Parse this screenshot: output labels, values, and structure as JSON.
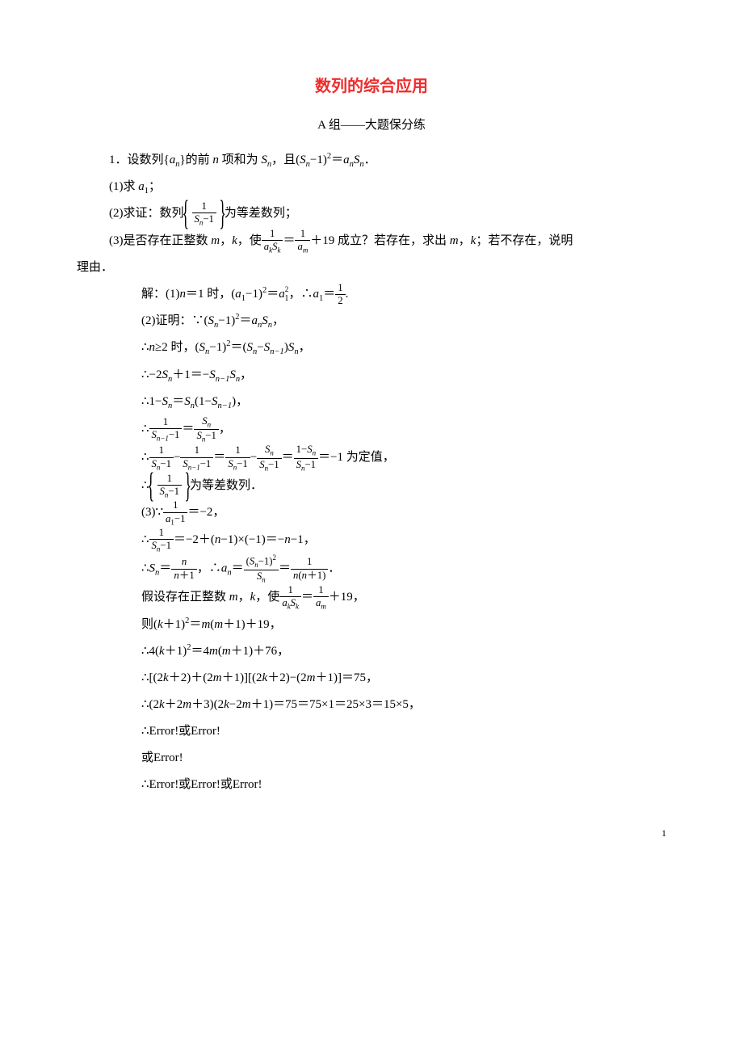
{
  "title": "数列的综合应用",
  "subtitle": "A 组——大题保分练",
  "p1": "1．设数列{",
  "p1b": "}的前 ",
  "p1c": " 项和为 ",
  "p1d": "，且(",
  "p1e": "−1)",
  "p1f": "＝",
  "p1g": "．",
  "q1": "(1)求 ",
  "q1b": "；",
  "q2a": "(2)求证：数列",
  "q2b": "为等差数列；",
  "q3a": "(3)是否存在正整数 ",
  "q3b": "，",
  "q3c": "，使",
  "q3d": "＝",
  "q3e": "＋19 成立？若存在，求出 ",
  "q3f": "，",
  "q3g": "；若不存在，说明",
  "q3h": "理由．",
  "s1a": "解：(1)",
  "s1b": "＝1 时，(",
  "s1c": "−1)",
  "s1d": "＝",
  "s1e": "，∴",
  "s1f": "＝",
  "s1g": ".",
  "s2a": "(2)证明：∵(",
  "s2b": "−1)",
  "s2c": "＝",
  "s2d": "，",
  "s3a": "∴",
  "s3b": "≥2 时，(",
  "s3c": "−1)",
  "s3d": "＝(",
  "s3e": "−",
  "s3f": ")",
  "s3g": "，",
  "s4a": "∴−2",
  "s4b": "＋1＝−",
  "s4c": "，",
  "s5a": "∴1−",
  "s5b": "＝",
  "s5c": "(1−",
  "s5d": ")，",
  "s6a": "∴",
  "s6b": "＝",
  "s6c": "，",
  "s7a": "∴",
  "s7b": "−",
  "s7c": "＝",
  "s7d": "−",
  "s7e": "＝",
  "s7f": "＝−1 为定值，",
  "s8a": "∴",
  "s8b": "为等差数列．",
  "s9a": "(3)∵",
  "s9b": "＝−2，",
  "s10a": "∴",
  "s10b": "＝−2＋(",
  "s10c": "−1)×(−1)＝−",
  "s10d": "−1，",
  "s11a": "∴",
  "s11b": "＝",
  "s11c": "，∴",
  "s11d": "＝",
  "s11e": "＝",
  "s11f": "．",
  "s12a": "假设存在正整数 ",
  "s12b": "，",
  "s12c": "，使",
  "s12d": "＝",
  "s12e": "＋19，",
  "s13a": "则(",
  "s13b": "＋1)",
  "s13c": "＝",
  "s13d": "(",
  "s13e": "＋1)＋19，",
  "s14a": "∴4(",
  "s14b": "＋1)",
  "s14c": "＝4",
  "s14d": "(",
  "s14e": "＋1)＋76，",
  "s15a": "∴[(2",
  "s15b": "＋2)＋(2",
  "s15c": "＋1)][(2",
  "s15d": "＋2)−(2",
  "s15e": "＋1)]＝75，",
  "s16a": "∴(2",
  "s16b": "＋2",
  "s16c": "＋3)(2",
  "s16d": "−2",
  "s16e": "＋1)＝75＝75×1＝25×3＝15×5，",
  "s17": "∴Error!或Error!",
  "s18": "或Error!",
  "s19": "∴Error!或Error!或Error!",
  "pagenum": "1",
  "var_an": {
    "a": "a",
    "n": "n"
  },
  "var_n": "n",
  "var_Sn": {
    "S": "S",
    "n": "n"
  },
  "var_a1": {
    "a": "a",
    "n": "1"
  },
  "var_m": "m",
  "var_k": "k",
  "two": "2",
  "frac_half": {
    "num": "1",
    "den": "2"
  },
  "frac_1_Sm1": {
    "num": "1",
    "den_l": "S",
    "den_s": "n",
    "den_r": "−1"
  },
  "frac_akSk_num": "1",
  "frac_akSk_den_a": "a",
  "frac_akSk_den_ks": "k",
  "frac_akSk_den_S": "S",
  "frac_akSk_den_ks2": "k",
  "frac_am_num": "1",
  "frac_am_den_a": "a",
  "frac_am_den_m": "m",
  "var_Snm1": {
    "S": "S",
    "n": "n−1"
  },
  "frac_Sn_Sm1_num_S": "S",
  "frac_Sn_Sm1_num_n": "n",
  "frac_Sn_Sm1_den_S": "S",
  "frac_Sn_Sm1_den_n": "n",
  "frac_Sn_Sm1_den_r": "−1",
  "frac_1mSn_num_l": "1−",
  "frac_1mSn_num_S": "S",
  "frac_1mSn_num_n": "n",
  "frac_a1m1_num": "1",
  "frac_a1m1_den_a": "a",
  "frac_a1m1_den_1": "1",
  "frac_a1m1_den_r": "−1",
  "frac_n_np1_num": "n",
  "frac_n_np1_den_n": "n",
  "frac_n_np1_den_r": "＋1",
  "frac_Snm1_Sn_num_l": "(",
  "frac_Snm1_Sn_num_S": "S",
  "frac_Snm1_Sn_num_n": "n",
  "frac_Snm1_Sn_num_r": "−1)",
  "frac_Snm1_Sn_num_2": "2",
  "frac_Snm1_Sn_den_S": "S",
  "frac_Snm1_Sn_den_n": "n",
  "frac_1_nnp1_num": "1",
  "frac_1_nnp1_den_n1": "n",
  "frac_1_nnp1_den_l": "(",
  "frac_1_nnp1_den_n2": "n",
  "frac_1_nnp1_den_r": "＋1)"
}
